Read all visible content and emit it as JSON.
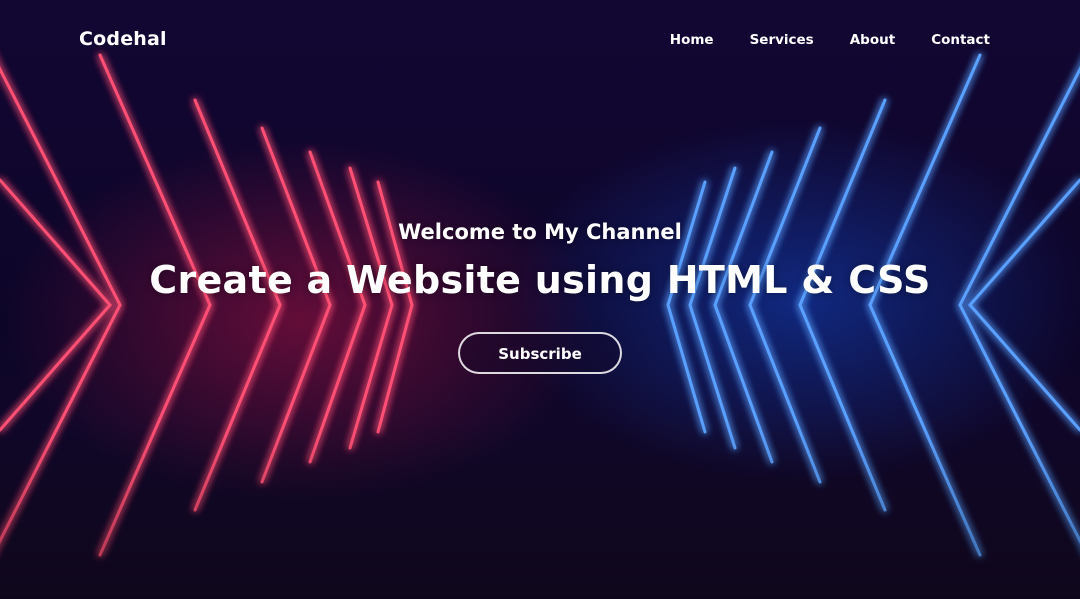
{
  "colors": {
    "background": "#0d0528",
    "neon_red": "#ff2a55",
    "neon_blue": "#2f7dff",
    "text": "#ffffff"
  },
  "header": {
    "logo": "Codehal",
    "nav": [
      {
        "label": "Home"
      },
      {
        "label": "Services"
      },
      {
        "label": "About"
      },
      {
        "label": "Contact"
      }
    ]
  },
  "hero": {
    "eyebrow": "Welcome to My Channel",
    "title": "Create a Website using HTML & CSS",
    "button_label": "Subscribe"
  }
}
